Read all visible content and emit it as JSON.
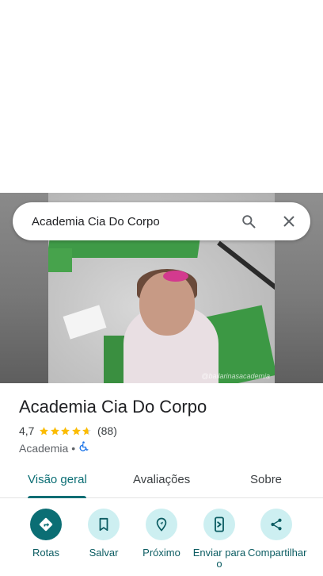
{
  "search": {
    "value": "Academia Cia Do Corpo"
  },
  "media": {
    "watermark": "@bailarinasacademia"
  },
  "place": {
    "name": "Academia Cia Do Corpo",
    "rating": "4,7",
    "rating_value": 4.7,
    "review_count": "(88)",
    "category": "Academia",
    "separator": "•",
    "accessibility_icon": "wheelchair-icon"
  },
  "tabs": [
    {
      "label": "Visão geral",
      "active": true
    },
    {
      "label": "Avaliações",
      "active": false
    },
    {
      "label": "Sobre",
      "active": false
    }
  ],
  "actions": [
    {
      "label": "Rotas",
      "icon": "directions-icon"
    },
    {
      "label": "Salvar",
      "icon": "bookmark-icon"
    },
    {
      "label": "Próximo",
      "icon": "nearby-icon"
    },
    {
      "label": "Enviar para o",
      "icon": "send-to-phone-icon"
    },
    {
      "label": "Compartilhar",
      "icon": "share-icon"
    }
  ],
  "colors": {
    "accent": "#0b6e74",
    "action_bg": "#cdeff1",
    "star": "#fbbc04",
    "accessibility": "#1a73e8"
  }
}
